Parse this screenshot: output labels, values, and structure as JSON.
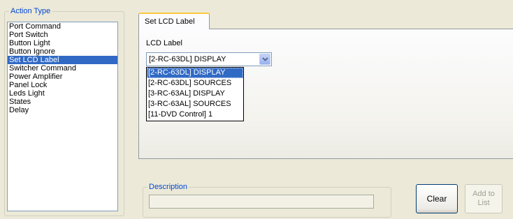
{
  "action_type": {
    "legend": "Action Type",
    "items": [
      {
        "label": "Port Command",
        "selected": false
      },
      {
        "label": "Port Switch",
        "selected": false
      },
      {
        "label": "Button Light",
        "selected": false
      },
      {
        "label": "Button Ignore",
        "selected": false
      },
      {
        "label": "Set LCD Label",
        "selected": true
      },
      {
        "label": "Switcher Command",
        "selected": false
      },
      {
        "label": "Power Amplifier",
        "selected": false
      },
      {
        "label": "Panel Lock",
        "selected": false
      },
      {
        "label": "Leds Light",
        "selected": false
      },
      {
        "label": "States",
        "selected": false
      },
      {
        "label": "Delay",
        "selected": false
      }
    ]
  },
  "tab": {
    "label": "Set LCD Label"
  },
  "lcd_label": {
    "caption": "LCD Label",
    "selected_value": "[2-RC-63DL] DISPLAY",
    "options": [
      {
        "label": "[2-RC-63DL] DISPLAY",
        "selected": true
      },
      {
        "label": "[2-RC-63DL] SOURCES",
        "selected": false
      },
      {
        "label": "[3-RC-63AL] DISPLAY",
        "selected": false
      },
      {
        "label": "[3-RC-63AL] SOURCES",
        "selected": false
      },
      {
        "label": "[11-DVD Control] 1",
        "selected": false
      }
    ]
  },
  "description": {
    "legend": "Description",
    "value": ""
  },
  "buttons": {
    "clear": "Clear",
    "add_to_list_line1": "Add to",
    "add_to_list_line2": "List"
  },
  "colors": {
    "selection": "#316AC5",
    "legend_text": "#0046D5",
    "background": "#ECE9D8"
  },
  "icons": {
    "dropdown_arrow": "chevron-down-icon"
  }
}
